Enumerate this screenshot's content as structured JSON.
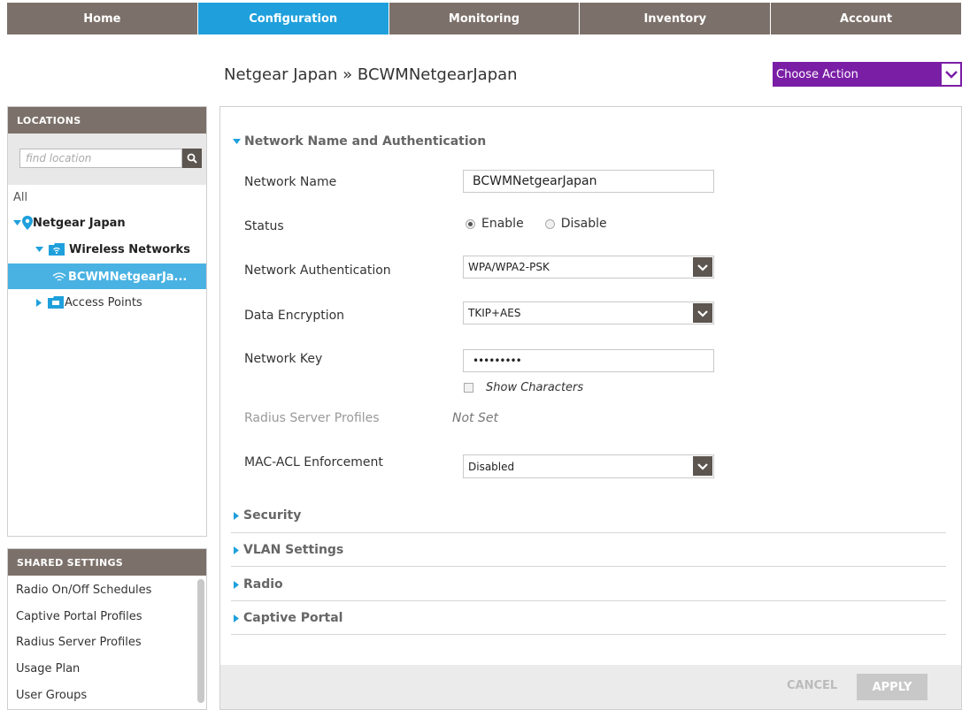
{
  "nav": {
    "tabs": [
      "Home",
      "Configuration",
      "Monitoring",
      "Inventory",
      "Account"
    ],
    "active": "Configuration"
  },
  "breadcrumb": "Netgear Japan » BCWMNetgearJapan",
  "choose_action": "Choose Action",
  "locations": {
    "header": "LOCATIONS",
    "search_placeholder": "find location",
    "all": "All",
    "root": "Netgear Japan",
    "wireless_networks": "Wireless Networks",
    "selected_network": "BCWMNetgearJa...",
    "access_points": "Access Points"
  },
  "shared": {
    "header": "SHARED SETTINGS",
    "items": [
      "Radio On/Off Schedules",
      "Captive Portal Profiles",
      "Radius Server Profiles",
      "Usage Plan",
      "User Groups"
    ]
  },
  "form": {
    "section_title": "Network Name and Authentication",
    "network_name_label": "Network Name",
    "network_name_value": "BCWMNetgearJapan",
    "status_label": "Status",
    "status_enable": "Enable",
    "status_disable": "Disable",
    "status_selected": "Enable",
    "auth_label": "Network Authentication",
    "auth_value": "WPA/WPA2-PSK",
    "encryption_label": "Data Encryption",
    "encryption_value": "TKIP+AES",
    "key_label": "Network Key",
    "key_value": "•••••••••",
    "show_characters": "Show Characters",
    "radius_label": "Radius Server Profiles",
    "radius_value": "Not Set",
    "macacl_label": "MAC-ACL Enforcement",
    "macacl_value": "Disabled"
  },
  "sections": [
    "Security",
    "VLAN Settings",
    "Radio",
    "Captive Portal"
  ],
  "footer": {
    "cancel": "CANCEL",
    "apply": "APPLY"
  },
  "colors": {
    "accent": "#1fa0dc",
    "nav": "#7c716a",
    "action": "#7a1ea6",
    "selected": "#49b2e3"
  }
}
